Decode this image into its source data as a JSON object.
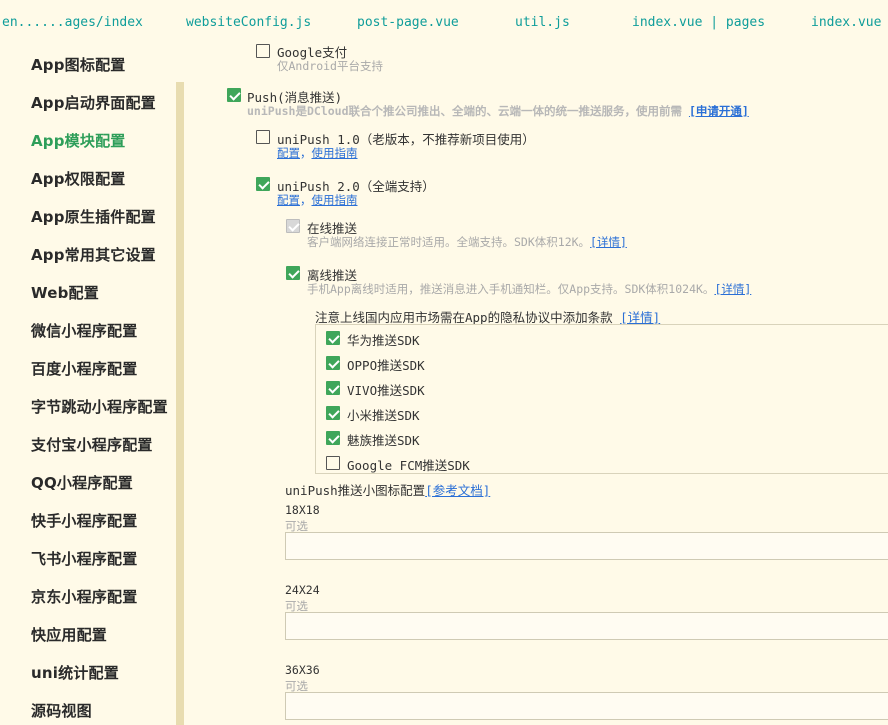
{
  "tabs": [
    "en......ages/index",
    "websiteConfig.js",
    "post-page.vue",
    "util.js",
    "index.vue | pages",
    "index.vue |"
  ],
  "sidebar": {
    "items": [
      "App图标配置",
      "App启动界面配置",
      "App模块配置",
      "App权限配置",
      "App原生插件配置",
      "App常用其它设置",
      "Web配置",
      "微信小程序配置",
      "百度小程序配置",
      "字节跳动小程序配置",
      "支付宝小程序配置",
      "QQ小程序配置",
      "快手小程序配置",
      "飞书小程序配置",
      "京东小程序配置",
      "快应用配置",
      "uni统计配置",
      "源码视图"
    ],
    "active_index": 2,
    "active_color": "#2e9e59"
  },
  "google_pay": {
    "label": "Google支付",
    "note": "仅Android平台支持",
    "checked": false
  },
  "push": {
    "label": "Push(消息推送)",
    "desc": "uniPush是DCloud联合个推公司推出、全端的、云端一体的统一推送服务，使用前需",
    "apply_link": "[申请开通]",
    "checked": true
  },
  "unipush1": {
    "label": "uniPush 1.0（老版本，不推荐新项目使用）",
    "config_link": "配置",
    "sep": "，",
    "guide_link": "使用指南",
    "checked": false
  },
  "unipush2": {
    "label": "uniPush 2.0（全端支持）",
    "config_link": "配置",
    "sep": "，",
    "guide_link": "使用指南",
    "checked": true
  },
  "online": {
    "label": "在线推送",
    "desc": "客户端网络连接正常时适用。全端支持。SDK体积12K。",
    "detail_link": "[详情]",
    "checked": true,
    "disabled": true
  },
  "offline": {
    "label": "离线推送",
    "desc": "手机App离线时适用，推送消息进入手机通知栏。仅App支持。SDK体积1024K。",
    "detail_link": "[详情]",
    "checked": true
  },
  "privacy_note": {
    "text": "注意上线国内应用市场需在App的隐私协议中添加条款",
    "detail_link": "[详情]"
  },
  "sdks": [
    {
      "label": "华为推送SDK",
      "checked": true
    },
    {
      "label": "OPPO推送SDK",
      "checked": true
    },
    {
      "label": "VIVO推送SDK",
      "checked": true
    },
    {
      "label": "小米推送SDK",
      "checked": true
    },
    {
      "label": "魅族推送SDK",
      "checked": true
    },
    {
      "label": "Google FCM推送SDK",
      "checked": false
    }
  ],
  "small_icon": {
    "title": "uniPush推送小图标配置",
    "doc_link": "[参考文档]",
    "fields": [
      {
        "size": "18X18",
        "note": "可选",
        "value": ""
      },
      {
        "size": "24X24",
        "note": "可选",
        "value": ""
      },
      {
        "size": "36X36",
        "note": "可选",
        "value": ""
      }
    ]
  },
  "check_color": "#3fa65a",
  "link_color": "#2a6fd6"
}
